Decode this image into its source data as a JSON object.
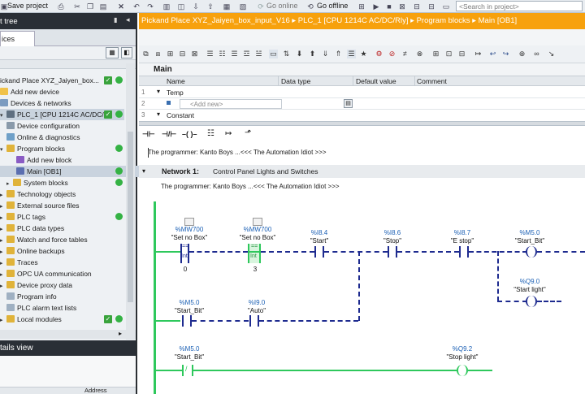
{
  "toolbar": {
    "save_label": "Save project",
    "go_online": "Go online",
    "go_offline": "Go offline",
    "search_placeholder": "<Search in project>"
  },
  "left_panel": {
    "title_partial": "t tree",
    "tab_devices": "ices",
    "details_view": "tails view",
    "details_col": "Address",
    "items": [
      {
        "label": "ickand Place XYZ_Jaiyen_box...",
        "status": "check"
      },
      {
        "label": "Add new device"
      },
      {
        "label": "Devices & networks"
      },
      {
        "label": "PLC_1 [CPU 1214C AC/DC/...",
        "status": "check"
      },
      {
        "label": "Device configuration"
      },
      {
        "label": "Online & diagnostics"
      },
      {
        "label": "Program blocks",
        "status": "dot"
      },
      {
        "label": "Add new block"
      },
      {
        "label": "Main [OB1]",
        "status": "dot"
      },
      {
        "label": "System blocks",
        "status": "dot"
      },
      {
        "label": "Technology objects"
      },
      {
        "label": "External source files"
      },
      {
        "label": "PLC tags",
        "status": "dot"
      },
      {
        "label": "PLC data types"
      },
      {
        "label": "Watch and force tables"
      },
      {
        "label": "Online backups"
      },
      {
        "label": "Traces"
      },
      {
        "label": "OPC UA communication"
      },
      {
        "label": "Device proxy data"
      },
      {
        "label": "Program info"
      },
      {
        "label": "PLC alarm text lists"
      },
      {
        "label": "Local modules",
        "status": "check"
      }
    ]
  },
  "editor": {
    "breadcrumb": [
      "Pickand Place XYZ_Jaiyen_box_input_V16",
      "PLC_1 [CPU 1214C AC/DC/Rly]",
      "Program blocks",
      "Main [OB1]"
    ],
    "block_title": "Main",
    "interface_headers": [
      "Name",
      "Data type",
      "Default value",
      "Comment"
    ],
    "interface_rows": [
      {
        "num": "1",
        "name": "Temp"
      },
      {
        "num": "2",
        "name": "<Add new>"
      },
      {
        "num": "3",
        "name": "Constant"
      }
    ],
    "block_comment": "The programmer: Kanto Boys ...<<< The Automation Idiot >>>",
    "network_title": "Network 1:",
    "network_name": "Control Panel Lights and Switches",
    "network_comment": "The programmer: Kanto Boys ...<<< The Automation Idiot >>>"
  },
  "ladder": {
    "rung1": [
      {
        "val": "0",
        "addr": "%MW700",
        "name": "\"Set no Box\"",
        "op": "==",
        "type": "Int",
        "const": "0"
      },
      {
        "val": "0",
        "addr": "%MW700",
        "name": "\"Set no Box\"",
        "op": "==",
        "type": "Int",
        "const": "3"
      },
      {
        "addr": "%I8.4",
        "name": "\"Start\""
      },
      {
        "addr": "%I8.6",
        "name": "\"Stop\""
      },
      {
        "addr": "%I8.7",
        "name": "\"E stop\""
      },
      {
        "addr": "%M5.0",
        "name": "\"Start_Bit\""
      },
      {
        "addr": "%Q9.0",
        "name": "\"Start light\""
      }
    ],
    "rung1_branch": [
      {
        "addr": "%M5.0",
        "name": "\"Start_Bit\""
      },
      {
        "addr": "%I9.0",
        "name": "\"Auto\""
      }
    ],
    "rung2": [
      {
        "addr": "%M5.0",
        "name": "\"Start_Bit\""
      },
      {
        "addr": "%Q9.2",
        "name": "\"Stop light\""
      }
    ]
  },
  "colors": {
    "title_bar": "#f7a10d",
    "rail": "#2ec85c",
    "wire": "#1e2b8f",
    "status_ok": "#34b244"
  }
}
